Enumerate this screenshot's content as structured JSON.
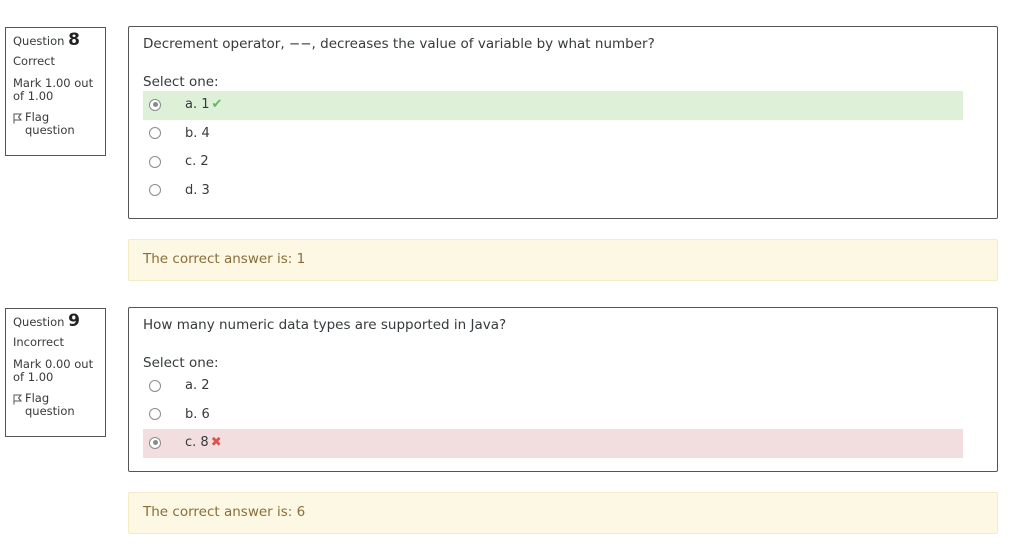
{
  "questions": [
    {
      "label": "Question",
      "number": "8",
      "state": "Correct",
      "grade": "Mark 1.00 out of 1.00",
      "flag_label": "Flag question",
      "text": "Decrement operator, −−, decreases the value of variable by what number?",
      "prompt": "Select one:",
      "options": [
        {
          "label": "a. 1",
          "selected": true,
          "result": "correct",
          "mark_icon": "check-icon"
        },
        {
          "label": "b. 4",
          "selected": false
        },
        {
          "label": "c. 2",
          "selected": false
        },
        {
          "label": "d. 3",
          "selected": false
        }
      ],
      "feedback": "The correct answer is: 1"
    },
    {
      "label": "Question",
      "number": "9",
      "state": "Incorrect",
      "grade": "Mark 0.00 out of 1.00",
      "flag_label": "Flag question",
      "text": "How many numeric data types are supported in Java?",
      "prompt": "Select one:",
      "options": [
        {
          "label": "a. 2",
          "selected": false
        },
        {
          "label": "b. 6",
          "selected": false
        },
        {
          "label": "c. 8",
          "selected": true,
          "result": "incorrect",
          "mark_icon": "cross-icon"
        }
      ],
      "feedback": "The correct answer is: 6"
    }
  ],
  "colors": {
    "correct_bg": "#dff0d8",
    "incorrect_bg": "#f2dede",
    "feedback_bg": "#fcf8e3",
    "check": "#5cb85c",
    "cross": "#d9534f"
  }
}
